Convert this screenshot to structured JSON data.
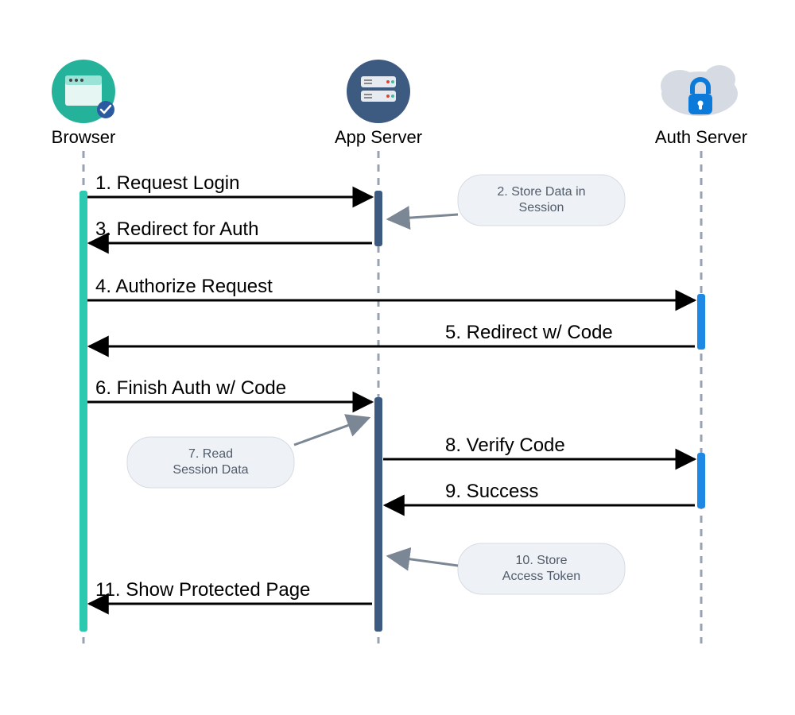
{
  "actors": {
    "browser": "Browser",
    "app_server": "App Server",
    "auth_server": "Auth Server"
  },
  "messages": {
    "m1": "1. Request Login",
    "m3": "3. Redirect for Auth",
    "m4": "4. Authorize Request",
    "m5": "5. Redirect w/ Code",
    "m6": "6. Finish Auth w/ Code",
    "m8": "8. Verify Code",
    "m9": "9. Success",
    "m11": "11. Show Protected Page"
  },
  "notes": {
    "n2a": "2. Store Data in",
    "n2b": "Session",
    "n7a": "7. Read",
    "n7b": "Session Data",
    "n10a": "10. Store",
    "n10b": "Access Token"
  },
  "colors": {
    "browser_circle": "#24B29A",
    "server_circle": "#3D5A80",
    "cloud": "#D6DBE3",
    "lock": "#0C7AD8",
    "lifeline": "#98A2B3",
    "browser_bar": "#2AC9B0",
    "server_bar": "#3D5A80",
    "auth_bar": "#1E88E5",
    "note_fill": "#EEF1F6",
    "note_stroke": "#D6DBE3",
    "note_arrow": "#7B8794",
    "black": "#000000"
  }
}
